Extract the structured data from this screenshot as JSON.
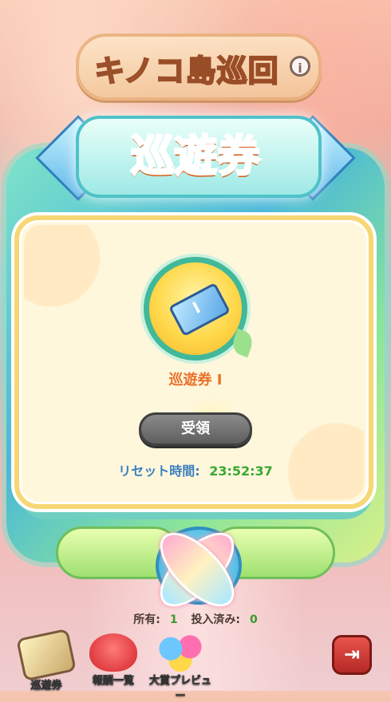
{
  "header": {
    "title": "キノコ島巡回",
    "info_icon": "i"
  },
  "banner": {
    "title": "巡遊券"
  },
  "reward": {
    "icon": "ticket-icon",
    "name": "巡遊券 I",
    "claim_label": "受領",
    "claim_enabled": false
  },
  "reset": {
    "label": "リセット時間:",
    "time": "23:52:37"
  },
  "status": {
    "owned_label": "所有:",
    "owned_value": "1",
    "invest_label": "投入済み:",
    "invest_value": "0"
  },
  "nav": {
    "items": [
      {
        "label": "巡遊券",
        "icon": "ticket-icon"
      },
      {
        "label": "報酬一覧",
        "icon": "heart-icon"
      },
      {
        "label": "大賞プレビュー",
        "icon": "balloon-icon"
      }
    ],
    "exit_icon": "exit-icon"
  },
  "colors": {
    "accent_orange": "#ff7a1c",
    "reset_label": "#3b7fbf",
    "reset_time": "#38a82e",
    "card_border": "#f7d774"
  }
}
